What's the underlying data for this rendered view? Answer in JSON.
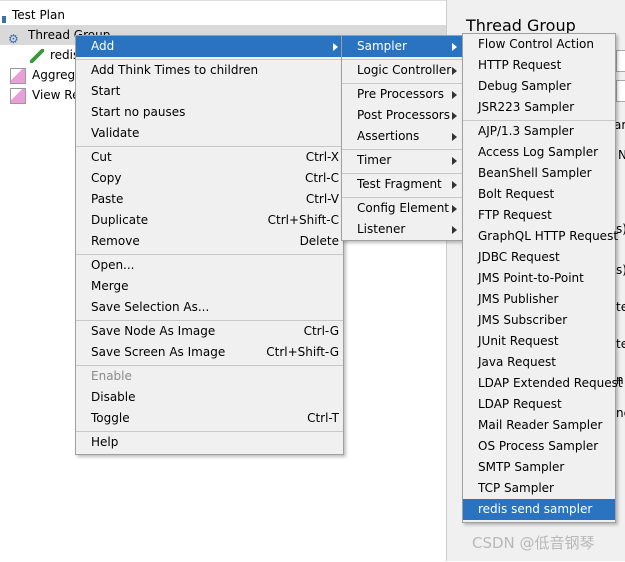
{
  "tree": {
    "items": [
      {
        "label": "Test Plan",
        "icon": "test-plan-icon"
      },
      {
        "label": "Thread Group",
        "icon": "gear-icon",
        "selected": true
      },
      {
        "label": "redis",
        "icon": "dropper-icon"
      },
      {
        "label": "Aggrega",
        "icon": "graph-icon"
      },
      {
        "label": "View Re",
        "icon": "graph-icon"
      }
    ]
  },
  "right_panel": {
    "title": "Thread Group",
    "fragments": [
      "ar",
      "N",
      "s):",
      "s):",
      "te",
      "ter",
      "n",
      "ne"
    ]
  },
  "context_menu": {
    "items": [
      {
        "label": "Add",
        "submenu": true,
        "highlighted": true
      },
      {
        "sep": true
      },
      {
        "label": "Add Think Times to children"
      },
      {
        "label": "Start"
      },
      {
        "label": "Start no pauses"
      },
      {
        "label": "Validate"
      },
      {
        "sep": true
      },
      {
        "label": "Cut",
        "shortcut": "Ctrl-X"
      },
      {
        "label": "Copy",
        "shortcut": "Ctrl-C"
      },
      {
        "label": "Paste",
        "shortcut": "Ctrl-V"
      },
      {
        "label": "Duplicate",
        "shortcut": "Ctrl+Shift-C"
      },
      {
        "label": "Remove",
        "shortcut": "Delete"
      },
      {
        "sep": true
      },
      {
        "label": "Open..."
      },
      {
        "label": "Merge"
      },
      {
        "label": "Save Selection As..."
      },
      {
        "sep": true
      },
      {
        "label": "Save Node As Image",
        "shortcut": "Ctrl-G"
      },
      {
        "label": "Save Screen As Image",
        "shortcut": "Ctrl+Shift-G"
      },
      {
        "sep": true
      },
      {
        "label": "Enable",
        "disabled": true
      },
      {
        "label": "Disable"
      },
      {
        "label": "Toggle",
        "shortcut": "Ctrl-T"
      },
      {
        "sep": true
      },
      {
        "label": "Help"
      }
    ]
  },
  "add_menu": {
    "items": [
      {
        "label": "Sampler",
        "submenu": true,
        "highlighted": true
      },
      {
        "sep": true
      },
      {
        "label": "Logic Controller",
        "submenu": true
      },
      {
        "sep": true
      },
      {
        "label": "Pre Processors",
        "submenu": true
      },
      {
        "label": "Post Processors",
        "submenu": true
      },
      {
        "label": "Assertions",
        "submenu": true
      },
      {
        "sep": true
      },
      {
        "label": "Timer",
        "submenu": true
      },
      {
        "sep": true
      },
      {
        "label": "Test Fragment",
        "submenu": true
      },
      {
        "sep": true
      },
      {
        "label": "Config Element",
        "submenu": true
      },
      {
        "label": "Listener",
        "submenu": true
      }
    ]
  },
  "sampler_menu": {
    "items": [
      {
        "label": "Flow Control Action"
      },
      {
        "label": "HTTP Request"
      },
      {
        "label": "Debug Sampler"
      },
      {
        "label": "JSR223 Sampler"
      },
      {
        "sep": true
      },
      {
        "label": "AJP/1.3 Sampler"
      },
      {
        "label": "Access Log Sampler"
      },
      {
        "label": "BeanShell Sampler"
      },
      {
        "label": "Bolt Request"
      },
      {
        "label": "FTP Request"
      },
      {
        "label": "GraphQL HTTP Request"
      },
      {
        "label": "JDBC Request"
      },
      {
        "label": "JMS Point-to-Point"
      },
      {
        "label": "JMS Publisher"
      },
      {
        "label": "JMS Subscriber"
      },
      {
        "label": "JUnit Request"
      },
      {
        "label": "Java Request"
      },
      {
        "label": "LDAP Extended Request"
      },
      {
        "label": "LDAP Request"
      },
      {
        "label": "Mail Reader Sampler"
      },
      {
        "label": "OS Process Sampler"
      },
      {
        "label": "SMTP Sampler"
      },
      {
        "label": "TCP Sampler"
      },
      {
        "label": "redis send sampler",
        "highlighted": true
      }
    ]
  },
  "watermark": "CSDN @低音钢琴",
  "colors": {
    "highlight": "#2a73c0",
    "menu_bg": "#f0f0f0"
  }
}
